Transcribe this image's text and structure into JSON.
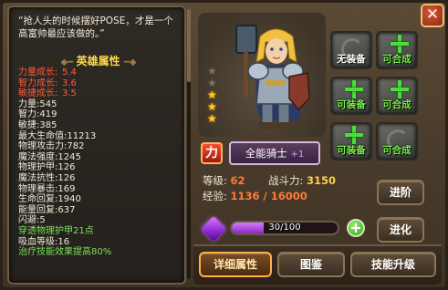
{
  "quote": "“抢人头的时候摆好POSE，才是一个高富帅最应该做的。”",
  "section_title": "英雄属性",
  "stats": [
    {
      "name": "力量成长:",
      "value": "5.4",
      "color": "red"
    },
    {
      "name": "智力成长:",
      "value": "3.6",
      "color": "red"
    },
    {
      "name": "敏捷成长:",
      "value": "3.5",
      "color": "red"
    },
    {
      "name": "力量:",
      "value": "545",
      "color": "white"
    },
    {
      "name": "智力:",
      "value": "419",
      "color": "white"
    },
    {
      "name": "敏捷:",
      "value": "385",
      "color": "white"
    },
    {
      "name": "最大生命值:",
      "value": "11213",
      "color": "white"
    },
    {
      "name": "物理攻击力:",
      "value": "782",
      "color": "white"
    },
    {
      "name": "魔法强度:",
      "value": "1245",
      "color": "white"
    },
    {
      "name": "物理护甲:",
      "value": "126",
      "color": "white"
    },
    {
      "name": "魔法抗性:",
      "value": "126",
      "color": "white"
    },
    {
      "name": "物理暴击:",
      "value": "169",
      "color": "white"
    },
    {
      "name": "生命回复:",
      "value": "1940",
      "color": "white"
    },
    {
      "name": "能量回复:",
      "value": "637",
      "color": "white"
    },
    {
      "name": "闪避:",
      "value": "5",
      "color": "white"
    },
    {
      "name": "穿透物理护甲",
      "value": "21点",
      "color": "green"
    },
    {
      "name": "吸血等级:",
      "value": "16",
      "color": "white"
    },
    {
      "name": "治疗技能效果提高",
      "value": "80%",
      "color": "green"
    }
  ],
  "hero": {
    "name": "全能骑士",
    "name_suffix": "+1",
    "class_icon": "力",
    "stars_total": 5,
    "stars_filled": 3
  },
  "equipment": [
    {
      "label": "无装备",
      "state": "empty",
      "label_color": "white"
    },
    {
      "label": "可合成",
      "state": "plus",
      "label_color": "green"
    },
    {
      "label": "可装备",
      "state": "plus",
      "label_color": "green"
    },
    {
      "label": "可合成",
      "state": "plus",
      "label_color": "green"
    },
    {
      "label": "可装备",
      "state": "plus",
      "label_color": "green"
    },
    {
      "label": "可合成",
      "state": "empty",
      "label_color": "green"
    }
  ],
  "info": {
    "level_label": "等级:",
    "level_value": "62",
    "power_label": "战斗力:",
    "power_value": "3150",
    "exp_label": "经验:",
    "exp_value": "1136 / 16000"
  },
  "soul": {
    "text": "30/100",
    "fraction": 0.3
  },
  "buttons": {
    "advance": "进阶",
    "evolve": "进化",
    "details": "详细属性",
    "codex": "图鉴",
    "skill_upgrade": "技能升级",
    "close": "✕",
    "add": "+"
  },
  "colors": {
    "accent_gold": "#ffcc44",
    "stat_red": "#ff5a3a",
    "stat_green": "#7ae05a",
    "soul_purple": "#c060ff"
  }
}
